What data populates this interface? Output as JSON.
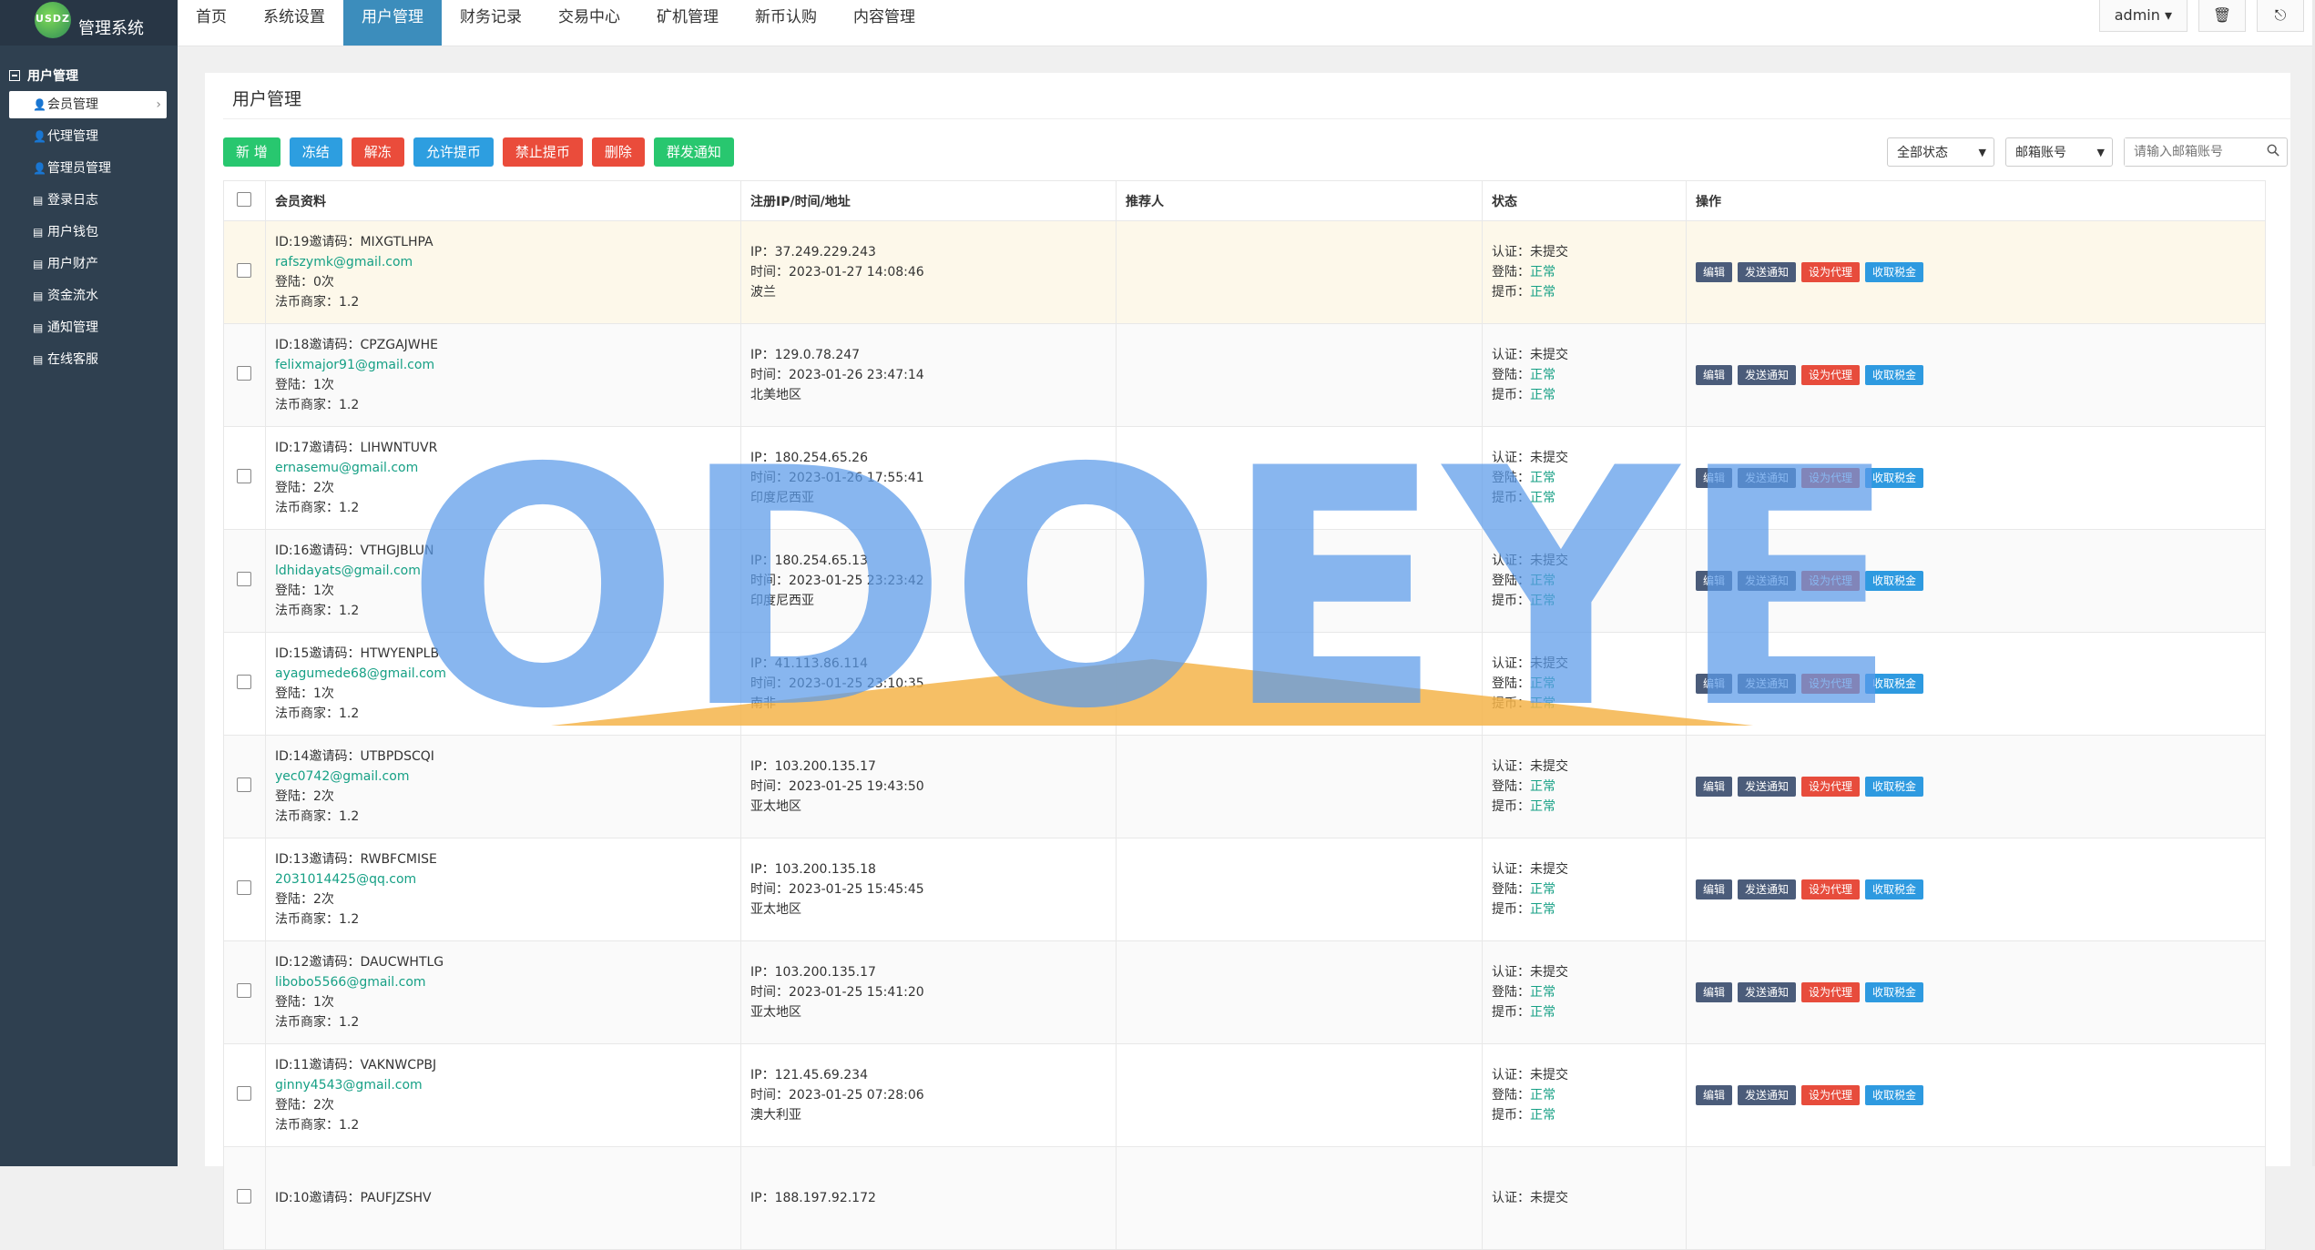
{
  "app": {
    "logo_mark": "USDZ",
    "title": "管理系统"
  },
  "sidebar": {
    "group": "用户管理",
    "items": [
      {
        "label": "会员管理",
        "icon": "user-icon"
      },
      {
        "label": "代理管理",
        "icon": "user-icon"
      },
      {
        "label": "管理员管理",
        "icon": "user-icon"
      },
      {
        "label": "登录日志",
        "icon": "list-icon"
      },
      {
        "label": "用户钱包",
        "icon": "list-icon"
      },
      {
        "label": "用户财产",
        "icon": "list-icon"
      },
      {
        "label": "资金流水",
        "icon": "list-icon"
      },
      {
        "label": "通知管理",
        "icon": "list-icon"
      },
      {
        "label": "在线客服",
        "icon": "list-icon"
      }
    ]
  },
  "topnav": [
    "首页",
    "系统设置",
    "用户管理",
    "财务记录",
    "交易中心",
    "矿机管理",
    "新币认购",
    "内容管理"
  ],
  "topright": {
    "admin": "admin ▾",
    "trash": "🗑",
    "logout": "⎋"
  },
  "panel": {
    "title": "用户管理"
  },
  "toolbar": {
    "add": "新 增",
    "freeze": "冻结",
    "unfreeze": "解冻",
    "allow_withdraw": "允许提币",
    "forbid_withdraw": "禁止提币",
    "delete": "删除",
    "broadcast": "群发通知"
  },
  "filters": {
    "status": "全部状态",
    "account": "邮箱账号",
    "search_placeholder": "请输入邮箱账号"
  },
  "table": {
    "headers": [
      "会员资料",
      "注册IP/时间/地址",
      "推荐人",
      "状态",
      "操作"
    ],
    "labels": {
      "login": "登陆：",
      "otc": "法币商家：",
      "ip": "IP：",
      "time": "时间：",
      "auth": "认证：",
      "login_status": "登陆：",
      "withdraw": "提币："
    },
    "actions": {
      "edit": "编辑",
      "notify": "发送通知",
      "agent": "设为代理",
      "tax": "收取税金"
    },
    "rows": [
      {
        "id": "ID:19邀请码：MIXGTLHPA",
        "email": "rafszymk@gmail.com",
        "login": "登陆：0次",
        "otc": "法币商家：1.2",
        "ip": "IP：37.249.229.243",
        "time": "时间：2023-01-27 14:08:46",
        "loc": "波兰",
        "auth": "认证：未提交",
        "ls": "正常",
        "wd": "正常"
      },
      {
        "id": "ID:18邀请码：CPZGAJWHE",
        "email": "felixmajor91@gmail.com",
        "login": "登陆：1次",
        "otc": "法币商家：1.2",
        "ip": "IP：129.0.78.247",
        "time": "时间：2023-01-26 23:47:14",
        "loc": "北美地区",
        "auth": "认证：未提交",
        "ls": "正常",
        "wd": "正常"
      },
      {
        "id": "ID:17邀请码：LIHWNTUVR",
        "email": "ernasemu@gmail.com",
        "login": "登陆：2次",
        "otc": "法币商家：1.2",
        "ip": "IP：180.254.65.26",
        "time": "时间：2023-01-26 17:55:41",
        "loc": "印度尼西亚",
        "auth": "认证：未提交",
        "ls": "正常",
        "wd": "正常"
      },
      {
        "id": "ID:16邀请码：VTHGJBLUN",
        "email": "ldhidayats@gmail.com",
        "login": "登陆：1次",
        "otc": "法币商家：1.2",
        "ip": "IP：180.254.65.13",
        "time": "时间：2023-01-25 23:23:42",
        "loc": "印度尼西亚",
        "auth": "认证：未提交",
        "ls": "正常",
        "wd": "正常"
      },
      {
        "id": "ID:15邀请码：HTWYENPLB",
        "email": "ayagumede68@gmail.com",
        "login": "登陆：1次",
        "otc": "法币商家：1.2",
        "ip": "IP：41.113.86.114",
        "time": "时间：2023-01-25 23:10:35",
        "loc": "南非",
        "auth": "认证：未提交",
        "ls": "正常",
        "wd": "正常"
      },
      {
        "id": "ID:14邀请码：UTBPDSCQI",
        "email": "yec0742@gmail.com",
        "login": "登陆：2次",
        "otc": "法币商家：1.2",
        "ip": "IP：103.200.135.17",
        "time": "时间：2023-01-25 19:43:50",
        "loc": "亚太地区",
        "auth": "认证：未提交",
        "ls": "正常",
        "wd": "正常"
      },
      {
        "id": "ID:13邀请码：RWBFCMISE",
        "email": "2031014425@qq.com",
        "login": "登陆：2次",
        "otc": "法币商家：1.2",
        "ip": "IP：103.200.135.18",
        "time": "时间：2023-01-25 15:45:45",
        "loc": "亚太地区",
        "auth": "认证：未提交",
        "ls": "正常",
        "wd": "正常"
      },
      {
        "id": "ID:12邀请码：DAUCWHTLG",
        "email": "libobo5566@gmail.com",
        "login": "登陆：1次",
        "otc": "法币商家：1.2",
        "ip": "IP：103.200.135.17",
        "time": "时间：2023-01-25 15:41:20",
        "loc": "亚太地区",
        "auth": "认证：未提交",
        "ls": "正常",
        "wd": "正常"
      },
      {
        "id": "ID:11邀请码：VAKNWCPBJ",
        "email": "ginny4543@gmail.com",
        "login": "登陆：2次",
        "otc": "法币商家：1.2",
        "ip": "IP：121.45.69.234",
        "time": "时间：2023-01-25 07:28:06",
        "loc": "澳大利亚",
        "auth": "认证：未提交",
        "ls": "正常",
        "wd": "正常"
      },
      {
        "id": "ID:10邀请码：PAUFJZSHV",
        "email": "",
        "login": "",
        "otc": "",
        "ip": "IP：188.197.92.172",
        "time": "",
        "loc": "",
        "auth": "认证：未提交",
        "ls": "",
        "wd": ""
      }
    ]
  },
  "watermark": {
    "text": "ODOEYE"
  }
}
